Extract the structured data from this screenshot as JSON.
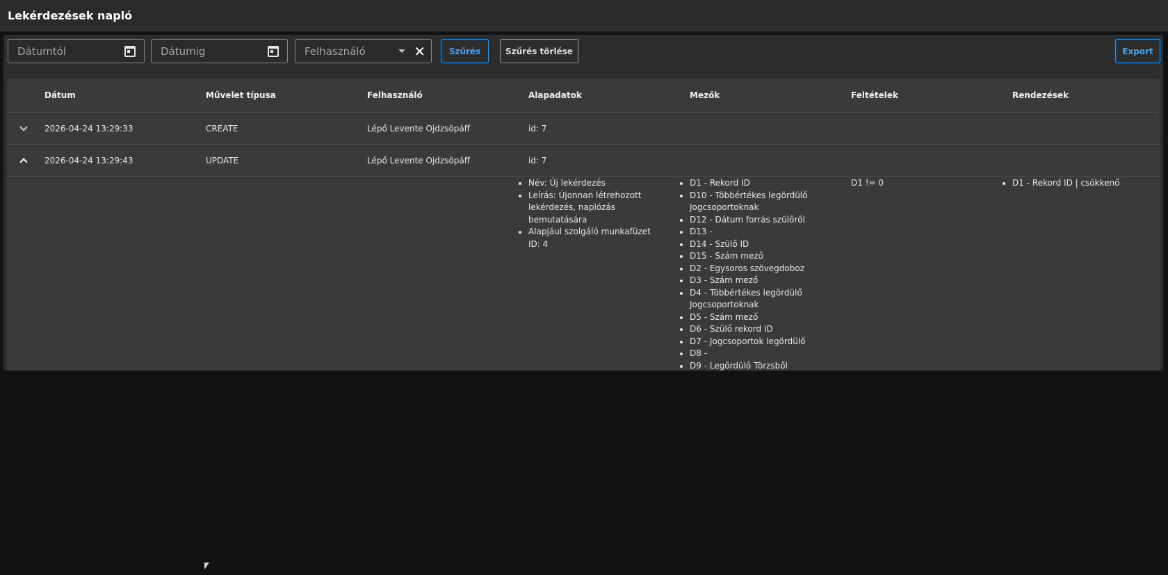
{
  "header": {
    "title": "Lekérdezések napló"
  },
  "filters": {
    "date_from_placeholder": "Dátumtól",
    "date_to_placeholder": "Dátumig",
    "user_placeholder": "Felhasználó",
    "filter_button": "Szűrés",
    "clear_filter_button": "Szűrés törlése",
    "export_button": "Export"
  },
  "table": {
    "columns": [
      "Dátum",
      "Művelet típusa",
      "Felhasználó",
      "Alapadatok",
      "Mezők",
      "Feltételek",
      "Rendezések"
    ],
    "rows": [
      {
        "date": "2026-04-24 13:29:33",
        "operation": "CREATE",
        "user": "Lépő Levente Ojdzsöpáff",
        "base": "id: 7"
      },
      {
        "date": "2026-04-24 13:29:43",
        "operation": "UPDATE",
        "user": "Lépő Levente Ojdzsöpáff",
        "base": "id: 7"
      }
    ],
    "expanded": {
      "base_items": [
        "Név: Új lekérdezés",
        "Leírás: Újonnan létrehozott lekérdezés, naplózás bemutatására",
        "Alapjául szolgáló munkafüzet ID: 4"
      ],
      "field_items": [
        "D1 - Rekord ID",
        "D10 - Többértékes legördülő Jogcsoportoknak",
        "D12 - Dátum forrás szülőről",
        "D13 -",
        "D14 - Szülő ID",
        "D15 - Szám mező",
        "D2 - Egysoros szövegdoboz",
        "D3 - Szám mező",
        "D4 - Többértékes legördülő Jogcsoportoknak",
        "D5 - Szám mező",
        "D6 - Szülő rekord ID",
        "D7 - Jogcsoportok legördülő",
        "D8 -",
        "D9 - Legördülő Törzsből"
      ],
      "condition": "D1 != 0",
      "sort_items": [
        "D1 - Rekord ID | csökkenő"
      ]
    }
  },
  "icons": [
    "calendar-icon",
    "calendar-icon",
    "caret-down-icon",
    "close-icon",
    "chevron-down-icon",
    "chevron-up-icon"
  ],
  "colors": {
    "accent": "#2196f3",
    "background": "#121212",
    "panel": "#2d2d2d",
    "table": "#3a3a3a"
  }
}
